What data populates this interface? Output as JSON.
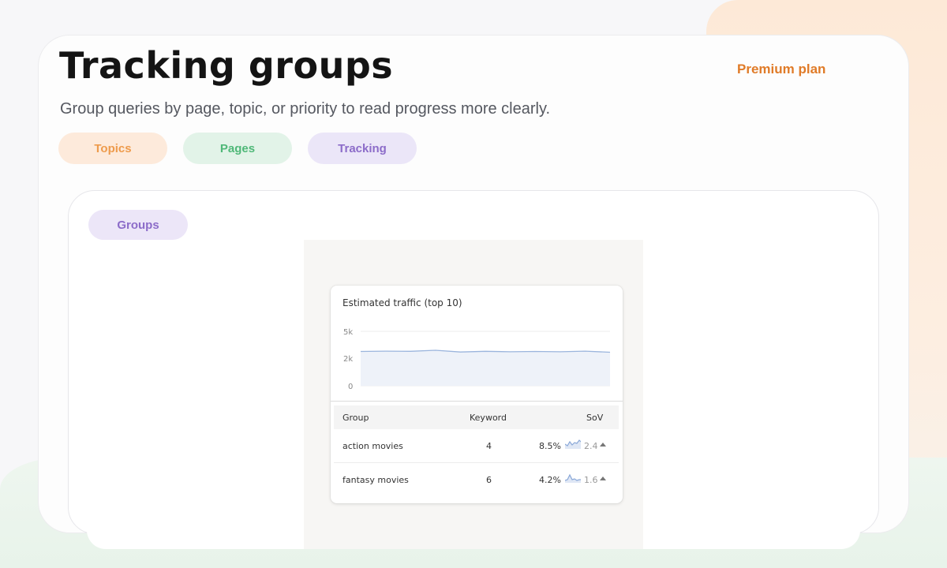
{
  "header": {
    "title": "Tracking groups",
    "plan_label": "Premium plan",
    "subtitle": "Group queries by page, topic, or priority to read progress more clearly."
  },
  "filters": [
    {
      "label": "Topics",
      "color": "#ee9b4c"
    },
    {
      "label": "Pages",
      "color": "#4fb878"
    },
    {
      "label": "Tracking",
      "color": "#8c6cc9"
    }
  ],
  "panel": {
    "tab_label": "Groups"
  },
  "widget": {
    "title": "Estimated traffic (top 10)",
    "chart_data": {
      "type": "area",
      "y_ticks": [
        "5k",
        "2k",
        "0"
      ],
      "ylim": [
        0,
        5000
      ],
      "values": [
        3150,
        3180,
        3170,
        3260,
        3100,
        3170,
        3120,
        3150,
        3120,
        3180,
        3080
      ],
      "color": "#9bb5dd"
    },
    "table": {
      "columns": [
        "Group",
        "Keyword",
        "SoV"
      ],
      "rows": [
        {
          "group": "action movies",
          "keyword": "4",
          "sov": "8.5%",
          "change": "2.4",
          "trend": "up"
        },
        {
          "group": "fantasy movies",
          "keyword": "6",
          "sov": "4.2%",
          "change": "1.6",
          "trend": "up"
        }
      ]
    }
  }
}
